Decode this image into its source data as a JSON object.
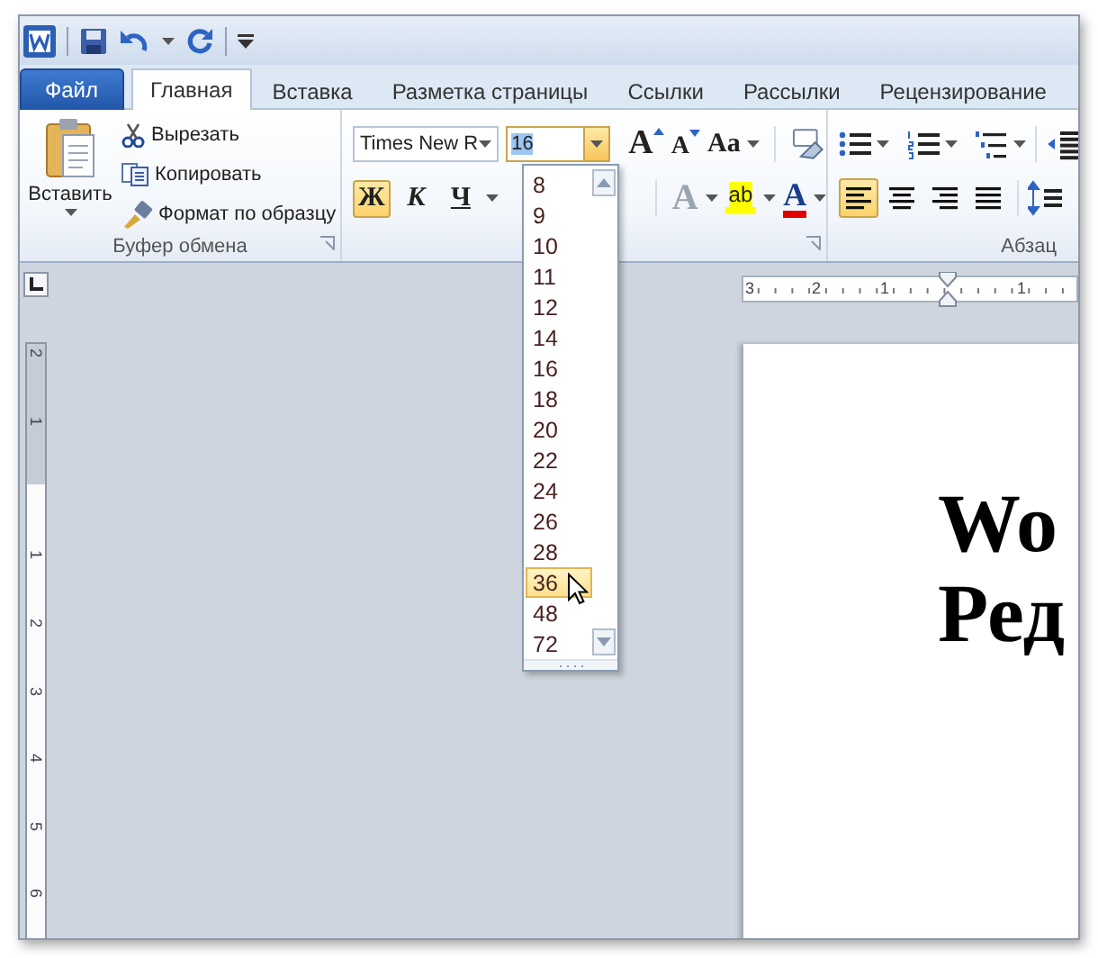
{
  "tabs": [
    {
      "label": "Файл",
      "kind": "file",
      "selected": false
    },
    {
      "label": "Главная",
      "kind": "tab",
      "selected": true
    },
    {
      "label": "Вставка",
      "kind": "tab",
      "selected": false
    },
    {
      "label": "Разметка страницы",
      "kind": "tab",
      "selected": false
    },
    {
      "label": "Ссылки",
      "kind": "tab",
      "selected": false
    },
    {
      "label": "Рассылки",
      "kind": "tab",
      "selected": false
    },
    {
      "label": "Рецензирование",
      "kind": "tab",
      "selected": false
    }
  ],
  "clipboard": {
    "paste": "Вставить",
    "commands": [
      {
        "kind": "cut",
        "label": "Вырезать"
      },
      {
        "kind": "copy",
        "label": "Копировать"
      },
      {
        "kind": "format_painter",
        "label": "Формат по образцу"
      }
    ],
    "label": "Буфер обмена"
  },
  "font": {
    "name": "Times New R",
    "size": "16",
    "row_1": [
      {
        "kind": "grow",
        "label": "A"
      },
      {
        "kind": "shrink",
        "label": "A"
      },
      {
        "kind": "case",
        "label": "Aa"
      },
      {
        "kind": "clear"
      }
    ],
    "row_2": [
      {
        "kind": "bold",
        "label": "Ж",
        "selected": true
      },
      {
        "kind": "italic",
        "label": "К",
        "selected": false
      },
      {
        "kind": "underline",
        "label": "Ч",
        "selected": false
      }
    ],
    "row_3": [
      {
        "kind": "effects",
        "label": "A",
        "disabled": true
      },
      {
        "kind": "highlight",
        "label": "ab",
        "color": "#ffff00"
      },
      {
        "kind": "color",
        "label": "A",
        "color": "#e00000"
      }
    ]
  },
  "size_list": {
    "items": [
      {
        "label": "8",
        "selected": false
      },
      {
        "label": "9",
        "selected": false
      },
      {
        "label": "10",
        "selected": false
      },
      {
        "label": "11",
        "selected": false
      },
      {
        "label": "12",
        "selected": false
      },
      {
        "label": "14",
        "selected": false
      },
      {
        "label": "16",
        "selected": false
      },
      {
        "label": "18",
        "selected": false
      },
      {
        "label": "20",
        "selected": false
      },
      {
        "label": "22",
        "selected": false
      },
      {
        "label": "24",
        "selected": false
      },
      {
        "label": "26",
        "selected": false
      },
      {
        "label": "28",
        "selected": false
      },
      {
        "label": "36",
        "selected": true
      },
      {
        "label": "48",
        "selected": false
      },
      {
        "label": "72",
        "selected": false
      }
    ]
  },
  "paragraph": {
    "label": "Абзац",
    "alignments": [
      {
        "kind": "left",
        "selected": true
      },
      {
        "kind": "center",
        "selected": false
      },
      {
        "kind": "right",
        "selected": false
      },
      {
        "kind": "justify",
        "selected": false
      }
    ]
  },
  "rulers": {
    "horizontal": [
      "3",
      "2",
      "1",
      "1"
    ],
    "vertical": [
      "2",
      "1",
      "1",
      "2",
      "3",
      "4",
      "5",
      "6"
    ]
  },
  "document": {
    "lines": [
      "Wo",
      "Ред"
    ]
  }
}
